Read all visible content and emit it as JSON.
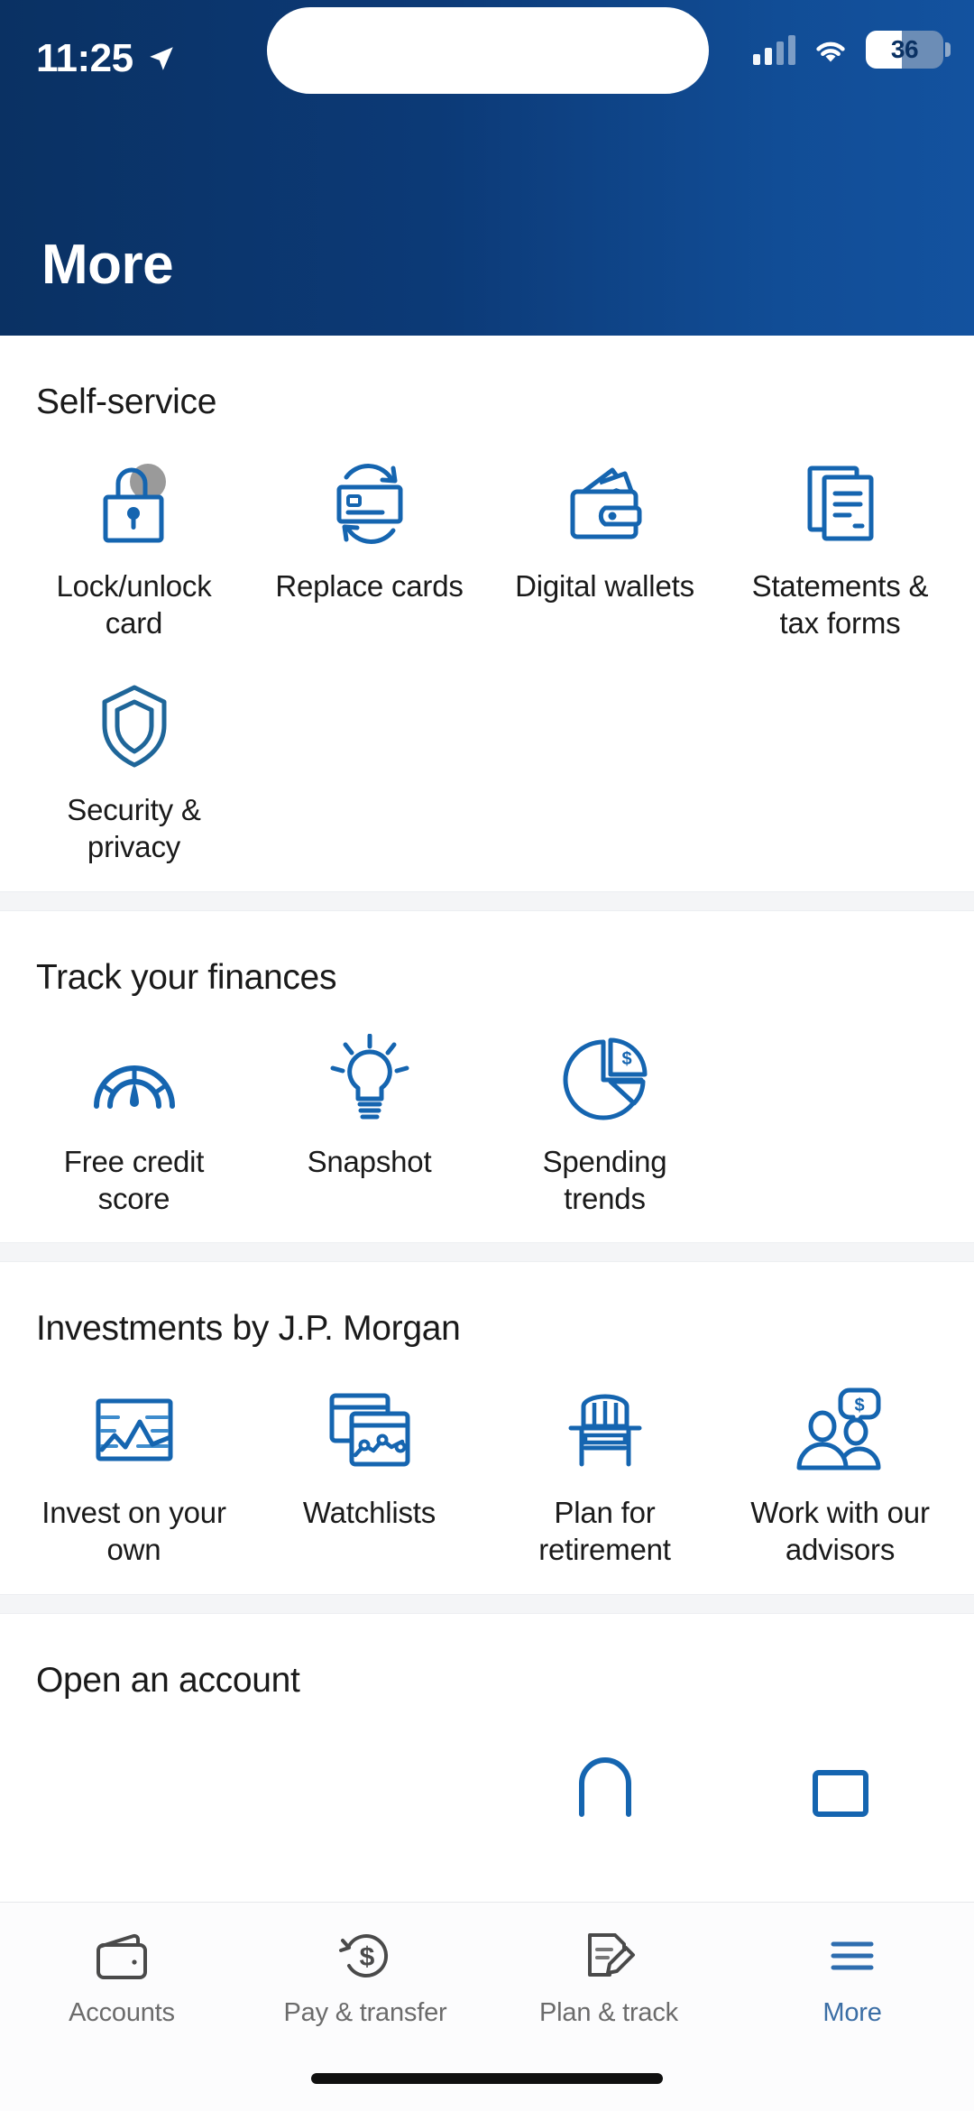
{
  "status_bar": {
    "time": "11:25",
    "battery_level": "36",
    "location_icon": "location-arrow-icon",
    "signal_icon": "cellular-signal-icon",
    "wifi_icon": "wifi-icon"
  },
  "header": {
    "title": "More"
  },
  "sections": [
    {
      "title": "Self-service",
      "items": [
        {
          "label": "Lock/unlock card",
          "icon": "padlock-icon"
        },
        {
          "label": "Replace cards",
          "icon": "credit-card-refresh-icon"
        },
        {
          "label": "Digital wallets",
          "icon": "wallet-icon"
        },
        {
          "label": "Statements & tax forms",
          "icon": "documents-stack-icon"
        },
        {
          "label": "Security & privacy",
          "icon": "shield-icon"
        }
      ]
    },
    {
      "title": "Track your finances",
      "items": [
        {
          "label": "Free credit score",
          "icon": "gauge-icon"
        },
        {
          "label": "Snapshot",
          "icon": "lightbulb-icon"
        },
        {
          "label": "Spending trends",
          "icon": "pie-chart-dollar-icon"
        }
      ]
    },
    {
      "title": "Investments by J.P. Morgan",
      "items": [
        {
          "label": "Invest on your own",
          "icon": "line-chart-icon"
        },
        {
          "label": "Watchlists",
          "icon": "stacked-charts-icon"
        },
        {
          "label": "Plan for retirement",
          "icon": "adirondack-chair-icon"
        },
        {
          "label": "Work with our advisors",
          "icon": "advisors-dollar-icon"
        }
      ]
    },
    {
      "title": "Open an account",
      "items": []
    }
  ],
  "bottom_nav": [
    {
      "label": "Accounts",
      "icon": "wallet-outline-icon",
      "active": false
    },
    {
      "label": "Pay & transfer",
      "icon": "dollar-refresh-icon",
      "active": false
    },
    {
      "label": "Plan & track",
      "icon": "document-pencil-icon",
      "active": false
    },
    {
      "label": "More",
      "icon": "hamburger-menu-icon",
      "active": true
    }
  ],
  "colors": {
    "header_start": "#0a3163",
    "header_end": "#13529f",
    "icon_blue": "#1565b0",
    "active_nav": "#3b6ea5",
    "inactive_nav": "#6b6b6b",
    "divider": "#f4f5f7"
  }
}
